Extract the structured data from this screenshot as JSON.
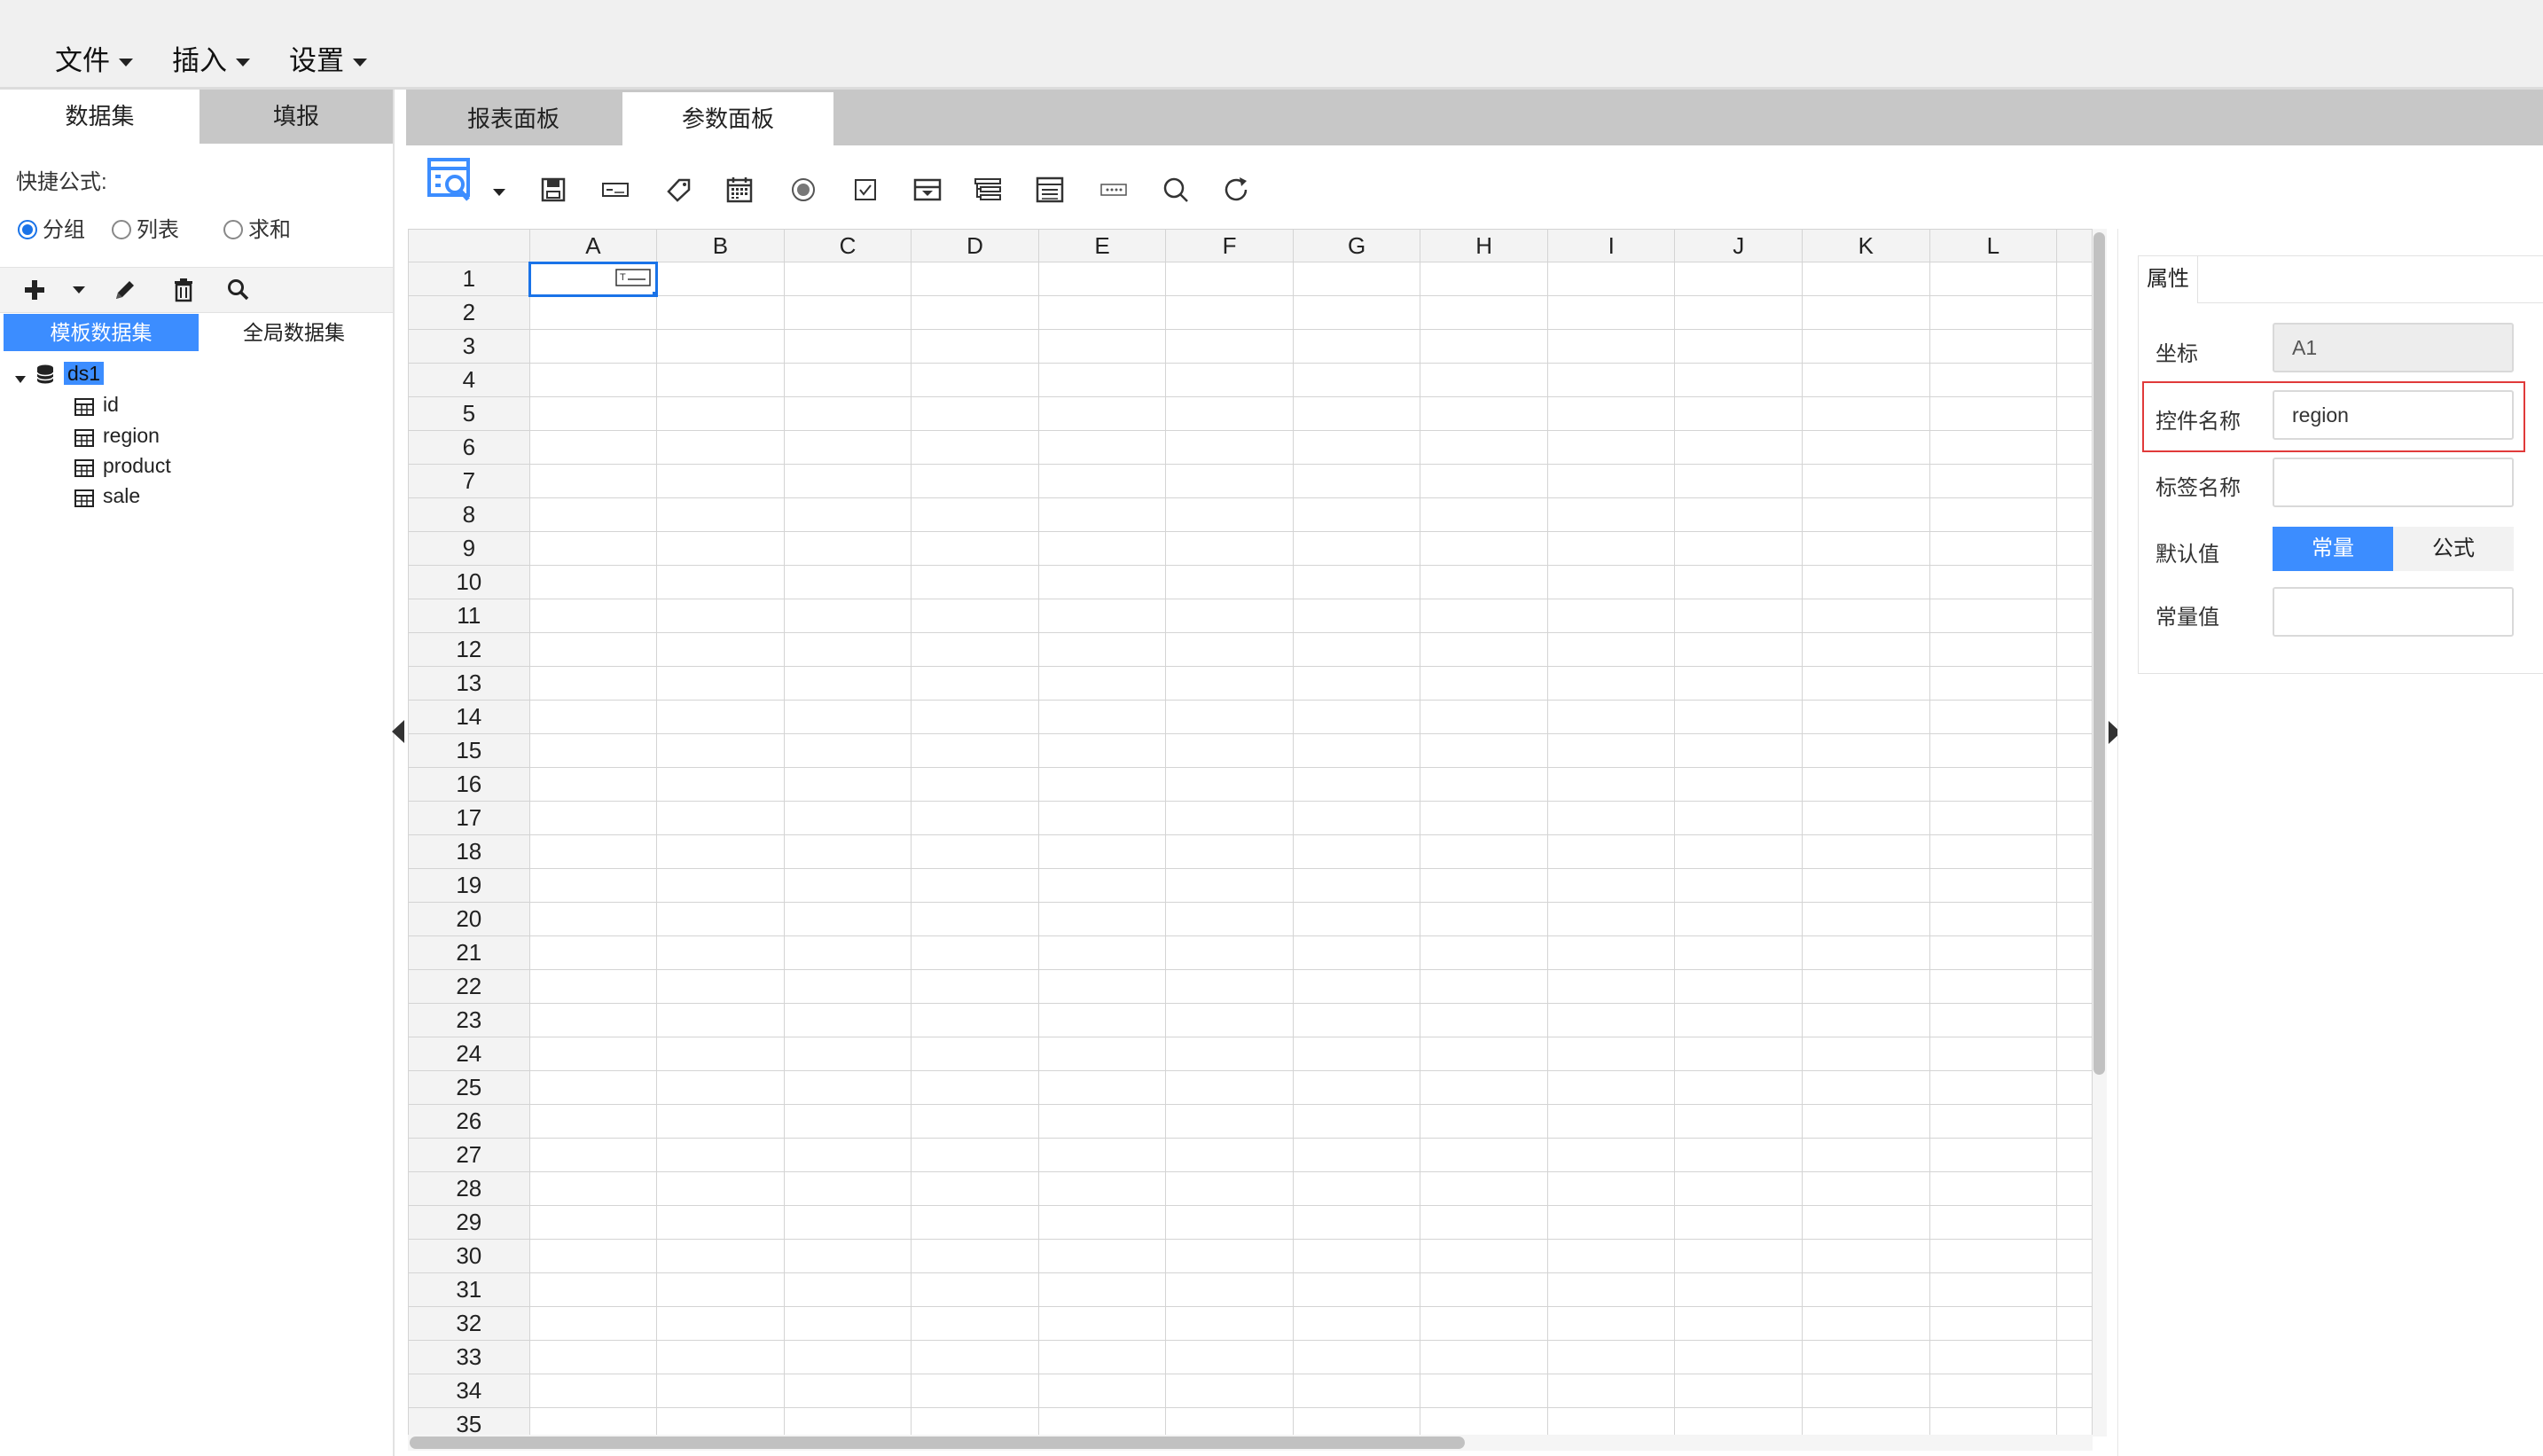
{
  "menu": [
    {
      "label": "文件"
    },
    {
      "label": "插入"
    },
    {
      "label": "设置"
    }
  ],
  "left_tabs": [
    "数据集",
    "填报"
  ],
  "quick_formula": {
    "label": "快捷公式:",
    "options": [
      {
        "label": "分组",
        "selected": true
      },
      {
        "label": "列表",
        "selected": false
      },
      {
        "label": "求和",
        "selected": false
      }
    ]
  },
  "dataset_subtabs": [
    "模板数据集",
    "全局数据集"
  ],
  "dataset_tree": {
    "name": "ds1",
    "fields": [
      "id",
      "region",
      "product",
      "sale"
    ]
  },
  "main_tabs": [
    {
      "label": "报表面板",
      "active": false
    },
    {
      "label": "参数面板",
      "active": true
    }
  ],
  "sheet": {
    "columns": [
      "A",
      "B",
      "C",
      "D",
      "E",
      "F",
      "G",
      "H",
      "I",
      "J",
      "K",
      "L"
    ],
    "row_count": 35,
    "selected_cell": "A1"
  },
  "properties": {
    "tab": "属性",
    "coord_label": "坐标",
    "coord_value": "A1",
    "widget_name_label": "控件名称",
    "widget_name_value": "region",
    "tag_name_label": "标签名称",
    "tag_name_value": "",
    "default_label": "默认值",
    "default_options": [
      "常量",
      "公式"
    ],
    "default_selected": "常量",
    "constant_label": "常量值",
    "constant_value": ""
  },
  "colors": {
    "accent": "#3c8dff",
    "highlight": "#e03a3a",
    "tab_inactive": "#c7c7c7"
  }
}
